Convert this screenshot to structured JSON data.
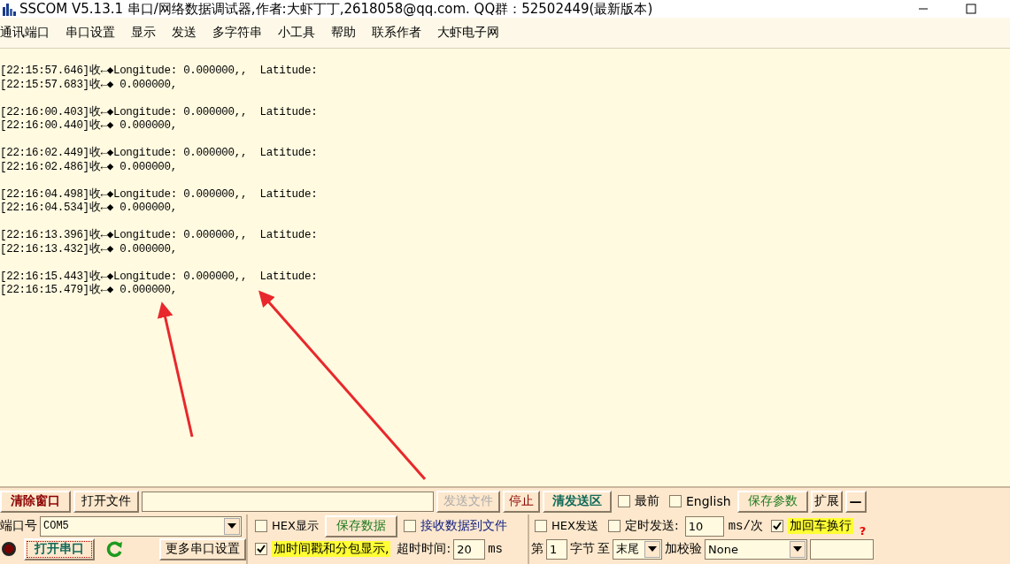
{
  "window": {
    "title": "SSCOM V5.13.1 串口/网络数据调试器,作者:大虾丁丁,2618058@qq.com. QQ群：52502449(最新版本)"
  },
  "menu": [
    "通讯端口",
    "串口设置",
    "显示",
    "发送",
    "多字符串",
    "小工具",
    "帮助",
    "联系作者",
    "大虾电子网"
  ],
  "log": [
    [
      "[22:15:57.646]收←◆Longitude: 0.000000,,  Latitude:",
      "[22:15:57.683]收←◆ 0.000000,"
    ],
    [
      "[22:16:00.403]收←◆Longitude: 0.000000,,  Latitude:",
      "[22:16:00.440]收←◆ 0.000000,"
    ],
    [
      "[22:16:02.449]收←◆Longitude: 0.000000,,  Latitude:",
      "[22:16:02.486]收←◆ 0.000000,"
    ],
    [
      "[22:16:04.498]收←◆Longitude: 0.000000,,  Latitude:",
      "[22:16:04.534]收←◆ 0.000000,"
    ],
    [
      "[22:16:13.396]收←◆Longitude: 0.000000,,  Latitude:",
      "[22:16:13.432]收←◆ 0.000000,"
    ],
    [
      "[22:16:15.443]收←◆Longitude: 0.000000,,  Latitude:",
      "[22:16:15.479]收←◆ 0.000000,"
    ]
  ],
  "send_bar": {
    "clear_button": "清除窗口",
    "open_file_button": "打开文件",
    "send_file_button": {
      "label": "发送文件",
      "disabled": true
    },
    "stop_button": "停止",
    "clear_send_button": "清发送区",
    "topmost": {
      "label": "最前",
      "checked": false
    },
    "english": {
      "label": "English",
      "checked": false
    },
    "save_params_button": "保存参数",
    "expand_button": "扩展",
    "collapse_button": "—"
  },
  "port": {
    "label": "端口号",
    "value": "COM5",
    "open": false,
    "open_button": "打开串口",
    "more_settings_button": "更多串口设置"
  },
  "receive": {
    "hex_display": {
      "label": "HEX显示",
      "checked": false
    },
    "save_button": "保存数据",
    "to_file": {
      "label": "接收数据到文件",
      "checked": false
    },
    "timestamp": {
      "label": "加时间戳和分包显示,",
      "checked": true
    },
    "timeout_label": "超时时间:",
    "timeout": "20",
    "timeout_unit": "ms"
  },
  "send": {
    "hex_send": {
      "label": "HEX发送",
      "checked": false
    },
    "timed_send": {
      "label": "定时发送:",
      "checked": false
    },
    "interval": "10",
    "interval_unit": "ms/次",
    "append_crlf": {
      "label": "加回车换行",
      "checked": true
    },
    "help": "?",
    "from_label": "第",
    "from": "1",
    "byte_label": "字节",
    "to_label": "至",
    "to": "末尾",
    "checksum_label": "加校验",
    "checksum": "None"
  }
}
